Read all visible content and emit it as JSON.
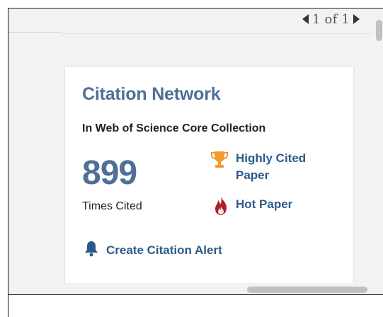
{
  "pager": {
    "text": "1 of 1"
  },
  "citation_card": {
    "title": "Citation Network",
    "subtitle": "In Web of Science Core Collection",
    "times_cited_value": "899",
    "times_cited_label": "Times Cited",
    "badges": [
      {
        "label": "Highly Cited Paper",
        "icon": "trophy-icon",
        "color": "#f29a2e"
      },
      {
        "label": "Hot Paper",
        "icon": "flame-icon",
        "color": "#b0202a"
      }
    ],
    "alert_label": "Create Citation Alert",
    "alert_icon": "bell-icon"
  },
  "colors": {
    "title_blue": "#4f6f96",
    "link_blue": "#2b5a8a",
    "panel_bg": "#f2f2f2"
  }
}
